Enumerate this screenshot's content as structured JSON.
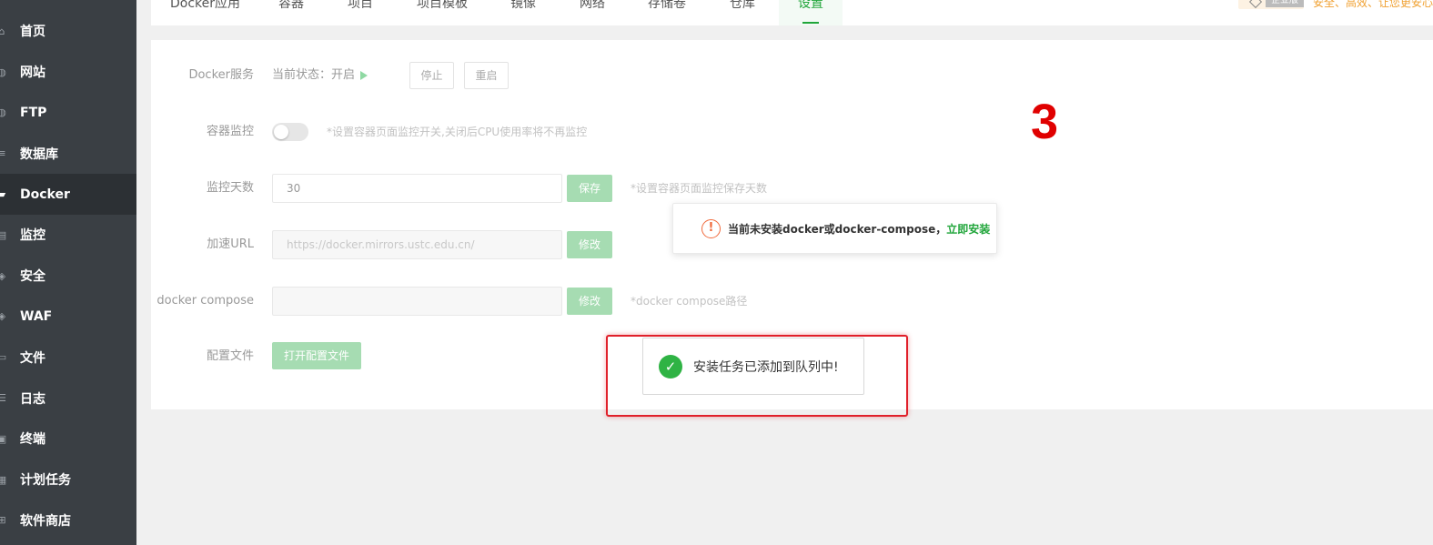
{
  "sidebar": {
    "items": [
      {
        "label": "首页",
        "icon": "home-icon",
        "glyph": "⌂"
      },
      {
        "label": "网站",
        "icon": "globe-icon",
        "glyph": "◍"
      },
      {
        "label": "FTP",
        "icon": "ftp-globe-icon",
        "glyph": "◍"
      },
      {
        "label": "数据库",
        "icon": "database-icon",
        "glyph": "≡"
      },
      {
        "label": "Docker",
        "icon": "docker-icon",
        "glyph": "▰"
      },
      {
        "label": "监控",
        "icon": "monitor-chart-icon",
        "glyph": "▤"
      },
      {
        "label": "安全",
        "icon": "shield-icon",
        "glyph": "◈"
      },
      {
        "label": "WAF",
        "icon": "waf-shield-icon",
        "glyph": "◈"
      },
      {
        "label": "文件",
        "icon": "folder-icon",
        "glyph": "▭"
      },
      {
        "label": "日志",
        "icon": "log-icon",
        "glyph": "☰"
      },
      {
        "label": "终端",
        "icon": "terminal-icon",
        "glyph": "▣"
      },
      {
        "label": "计划任务",
        "icon": "calendar-icon",
        "glyph": "▦"
      },
      {
        "label": "软件商店",
        "icon": "apps-grid-icon",
        "glyph": "⊞"
      }
    ],
    "active_index": 4
  },
  "tabs": [
    "Docker应用",
    "容器",
    "项目",
    "项目模板",
    "镜像",
    "网络",
    "存储卷",
    "仓库",
    "设置"
  ],
  "active_tab": "设置",
  "badge": {
    "label": "企业版",
    "text": "安全、高效、让您更安心"
  },
  "settings": {
    "service": {
      "label": "Docker服务",
      "status": "当前状态：开启",
      "stop": "停止",
      "restart": "重启"
    },
    "monitor": {
      "label": "容器监控",
      "hint": "*设置容器页面监控开关,关闭后CPU使用率将不再监控"
    },
    "days": {
      "label": "监控天数",
      "value": "30",
      "button": "保存",
      "hint": "*设置容器页面监控保存天数"
    },
    "mirror": {
      "label": "加速URL",
      "placeholder": "https://docker.mirrors.ustc.edu.cn/",
      "button": "修改"
    },
    "compose": {
      "label": "docker compose",
      "value": "",
      "button": "修改",
      "hint": "*docker compose路径"
    },
    "config": {
      "label": "配置文件",
      "button": "打开配置文件"
    }
  },
  "annotation_number": "3",
  "warning": {
    "icon": "!",
    "text": "当前未安装docker或docker-compose，",
    "link": "立即安装"
  },
  "toast": {
    "icon": "✓",
    "text": "安装任务已添加到队列中!"
  },
  "colors": {
    "accent": "#20a53a",
    "sidebar_bg": "#3a3f44",
    "warning": "#f06a3c",
    "highlight_frame": "#e0202a"
  }
}
